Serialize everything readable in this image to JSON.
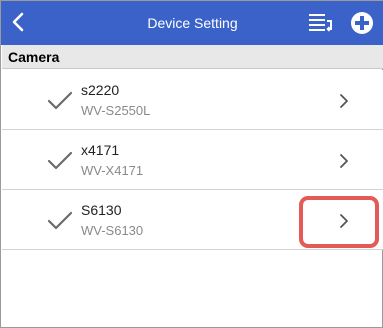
{
  "header": {
    "title": "Device Setting"
  },
  "section": {
    "title": "Camera"
  },
  "devices": [
    {
      "name": "s2220",
      "model": "WV-S2550L"
    },
    {
      "name": "x4171",
      "model": "WV-X4171"
    },
    {
      "name": "S6130",
      "model": "WV-S6130"
    }
  ],
  "colors": {
    "header_bg": "#3a62c9",
    "highlight": "#e35a57"
  },
  "icons": {
    "back": "back-arrow-icon",
    "list": "list-sort-icon",
    "add": "add-circle-icon",
    "check": "checkmark-icon",
    "chevron": "chevron-right-icon"
  }
}
